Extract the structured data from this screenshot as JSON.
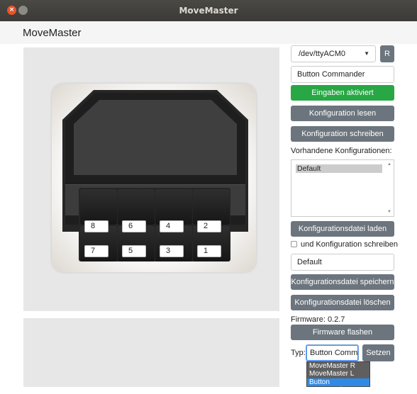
{
  "window": {
    "title": "MoveMaster"
  },
  "app": {
    "title": "MoveMaster"
  },
  "device": {
    "keys": [
      {
        "value": "8"
      },
      {
        "value": "6"
      },
      {
        "value": "4"
      },
      {
        "value": "2"
      },
      {
        "value": "7"
      },
      {
        "value": "5"
      },
      {
        "value": "3"
      },
      {
        "value": "1"
      }
    ]
  },
  "controls": {
    "port_select": {
      "value": "/dev/ttyACM0"
    },
    "refresh_label": "R",
    "device_name": "Button Commander",
    "enable_input_label": "Eingaben aktiviert",
    "read_config_label": "Konfiguration lesen",
    "write_config_label": "Konfiguration schreiben",
    "existing_configs_label": "Vorhandene Konfigurationen:",
    "configs": [
      "Default"
    ],
    "load_file_label": "Konfigurationsdatei laden",
    "and_write_label": "und Konfiguration schreiben",
    "filename_value": "Default",
    "save_file_label": "Konfigurationsdatei speichern",
    "delete_file_label": "Konfigurationsdatei löschen",
    "firmware_label": "Firmware: 0.2.7",
    "flash_label": "Firmware flashen",
    "type_label": "Typ:",
    "type_value": "Button Commander",
    "set_label": "Setzen",
    "type_options": [
      "MoveMaster R",
      "MoveMaster L",
      "Button Commander"
    ]
  },
  "colors": {
    "accent_green": "#28a745",
    "button_gray": "#6c757d",
    "selection_blue": "#2f8ae6"
  }
}
